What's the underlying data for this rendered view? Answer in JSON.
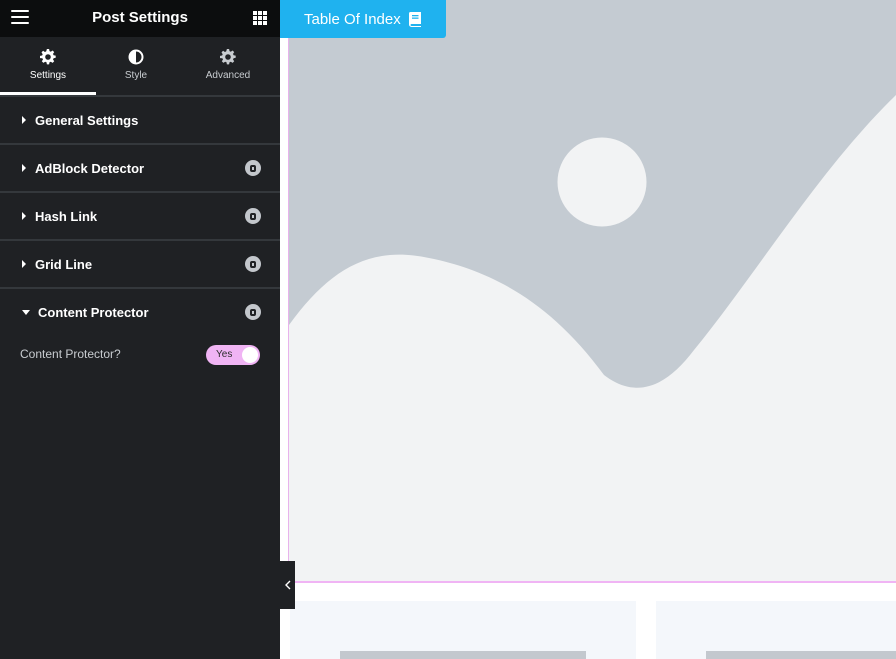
{
  "sidebar": {
    "title": "Post Settings",
    "tabs": [
      {
        "label": "Settings",
        "icon": "gear-icon",
        "active": true
      },
      {
        "label": "Style",
        "icon": "half-circle-icon",
        "active": false
      },
      {
        "label": "Advanced",
        "icon": "gear-icon",
        "active": false
      }
    ],
    "sections": [
      {
        "title": "General Settings",
        "open": false,
        "pro": false
      },
      {
        "title": "AdBlock Detector",
        "open": false,
        "pro": true
      },
      {
        "title": "Hash Link",
        "open": false,
        "pro": true
      },
      {
        "title": "Grid Line",
        "open": false,
        "pro": true
      },
      {
        "title": "Content Protector",
        "open": true,
        "pro": true
      }
    ],
    "control": {
      "label": "Content Protector?",
      "toggle_text": "Yes",
      "toggle_on": true
    }
  },
  "canvas": {
    "toc_tab_label": "Table Of Index"
  },
  "colors": {
    "sidebar_bg": "#1f2124",
    "header_bg": "#0c0d0e",
    "toc_tab": "#1fb2ef",
    "switch_on": "#f0b4f4",
    "placeholder_gray": "#c4cbd2",
    "placeholder_light": "#f2f3f4"
  }
}
